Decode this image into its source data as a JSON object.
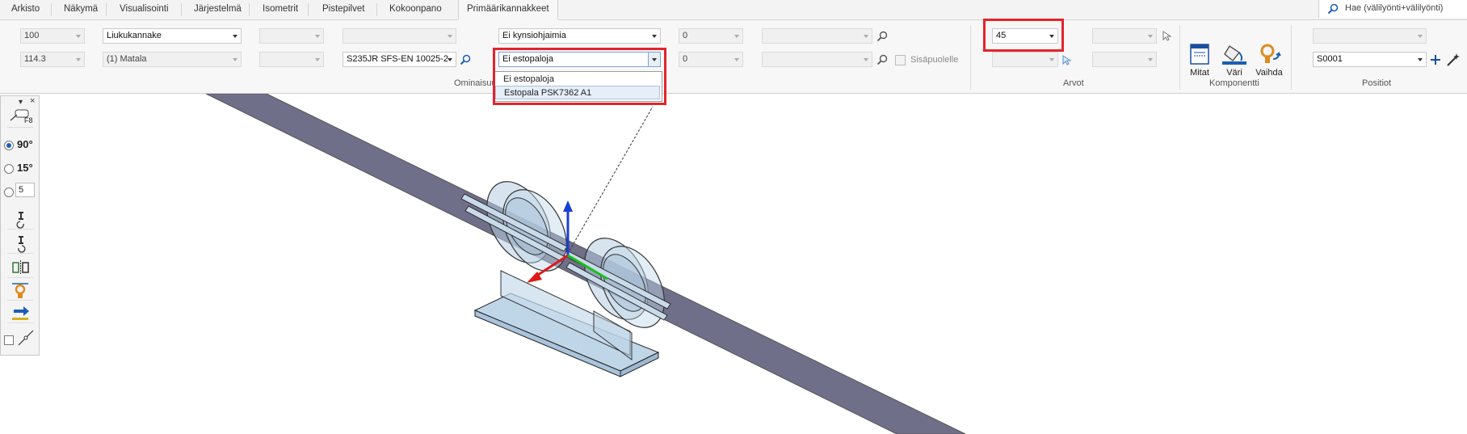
{
  "tabs": [
    "Arkisto",
    "Näkymä",
    "Visualisointi",
    "Järjestelmä",
    "Isometrit",
    "Pistepilvet",
    "Kokoonpano",
    "Primäärikannakkeet"
  ],
  "search": {
    "placeholder": "Hae (välilyönti+välilyönti)"
  },
  "ribbon": {
    "row1": {
      "size": "100",
      "type": "Liukukannake",
      "guide": "Ei kynsiohjaimia",
      "angle": "0",
      "value": "45"
    },
    "row2": {
      "diameter": "114.3",
      "height": "(1) Matala",
      "material": "S235JR SFS-EN 10025-2",
      "stopper": "Ei estopaloja",
      "angle2": "0",
      "inside_label": "Sisäpuolelle",
      "position": "S0001"
    },
    "dropdown_options": [
      "Ei estopaloja",
      "Estopala PSK7362 A1"
    ],
    "groups": {
      "ominaisuudet": "Ominaisuu",
      "arvot": "Arvot",
      "komponentti": "Komponentti",
      "positiot": "Positiot"
    },
    "buttons": {
      "mitat": "Mitat",
      "vari": "Väri",
      "vaihda": "Vaihda"
    }
  },
  "left_toolbar": {
    "f8": "F8",
    "angle90": "90°",
    "angle15": "15°",
    "custom_angle": "5"
  },
  "colors": {
    "accent": "#1a5fb4",
    "highlight": "#e3242b",
    "pipe": "#8e8ea8"
  }
}
